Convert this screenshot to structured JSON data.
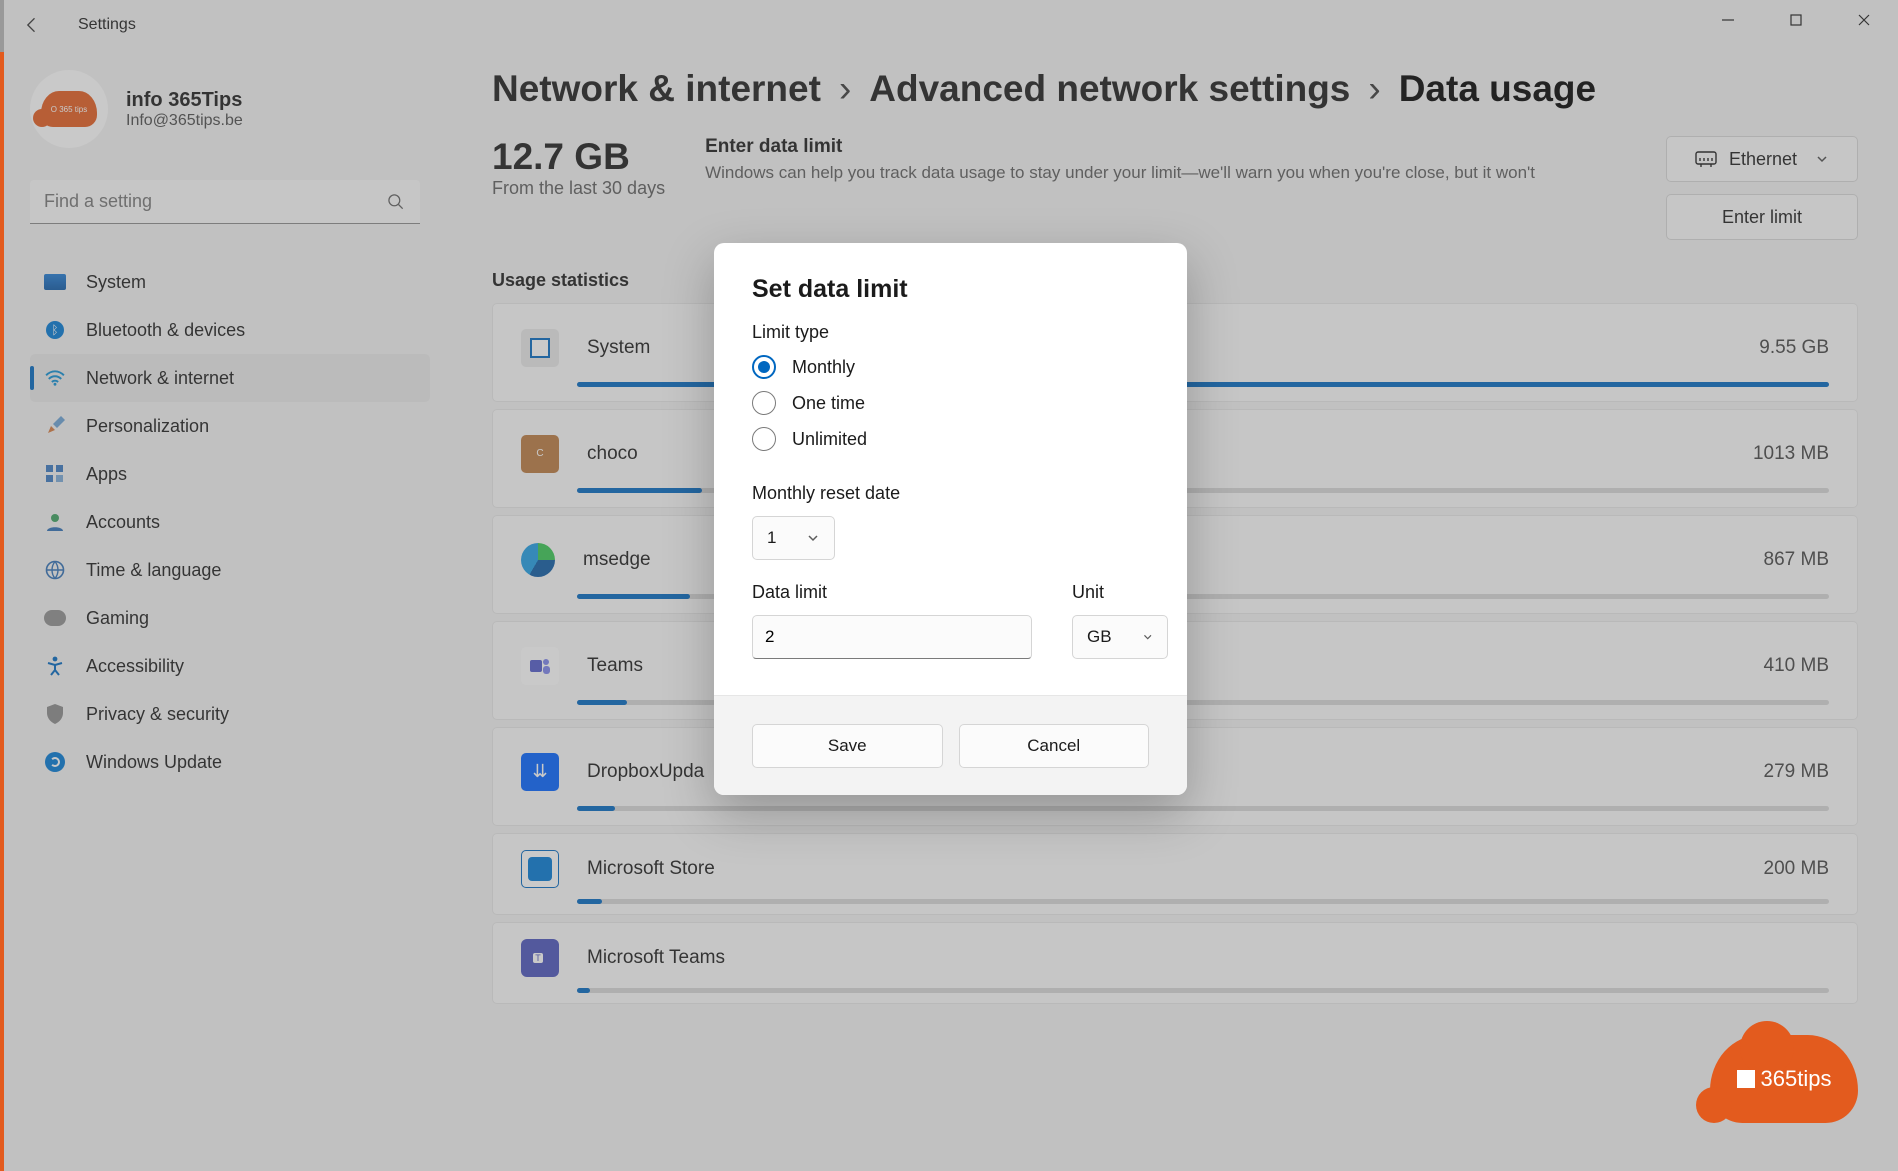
{
  "app_title": "Settings",
  "profile": {
    "name": "info 365Tips",
    "email": "Info@365tips.be"
  },
  "search_placeholder": "Find a setting",
  "nav": {
    "system": "System",
    "bluetooth": "Bluetooth & devices",
    "network": "Network & internet",
    "personalization": "Personalization",
    "apps": "Apps",
    "accounts": "Accounts",
    "time": "Time & language",
    "gaming": "Gaming",
    "accessibility": "Accessibility",
    "privacy": "Privacy & security",
    "update": "Windows Update"
  },
  "breadcrumb": {
    "a": "Network & internet",
    "b": "Advanced network settings",
    "c": "Data usage"
  },
  "summary": {
    "value": "12.7 GB",
    "sub": "From the last 30 days"
  },
  "limit": {
    "heading": "Enter data limit",
    "desc": "Windows can help you track data usage to stay under your limit—we'll warn you when you're close, but it won't"
  },
  "adapter_label": "Ethernet",
  "enter_limit_btn": "Enter limit",
  "stats_title": "Usage statistics",
  "apps": [
    {
      "name": "System",
      "amount": "9.55 GB",
      "pct": 100
    },
    {
      "name": "choco",
      "amount": "1013 MB",
      "pct": 10
    },
    {
      "name": "msedge",
      "amount": "867 MB",
      "pct": 9
    },
    {
      "name": "Teams",
      "amount": "410 MB",
      "pct": 4
    },
    {
      "name": "DropboxUpda",
      "amount": "279 MB",
      "pct": 3
    },
    {
      "name": "Microsoft Store",
      "amount": "200 MB",
      "pct": 2
    },
    {
      "name": "Microsoft Teams",
      "amount": "",
      "pct": 1
    }
  ],
  "dialog": {
    "title": "Set data limit",
    "limit_type_label": "Limit type",
    "opt_monthly": "Monthly",
    "opt_onetime": "One time",
    "opt_unlimited": "Unlimited",
    "reset_label": "Monthly reset date",
    "reset_value": "1",
    "data_limit_label": "Data limit",
    "data_limit_value": "2",
    "unit_label": "Unit",
    "unit_value": "GB",
    "save": "Save",
    "cancel": "Cancel"
  },
  "watermark": "365tips"
}
